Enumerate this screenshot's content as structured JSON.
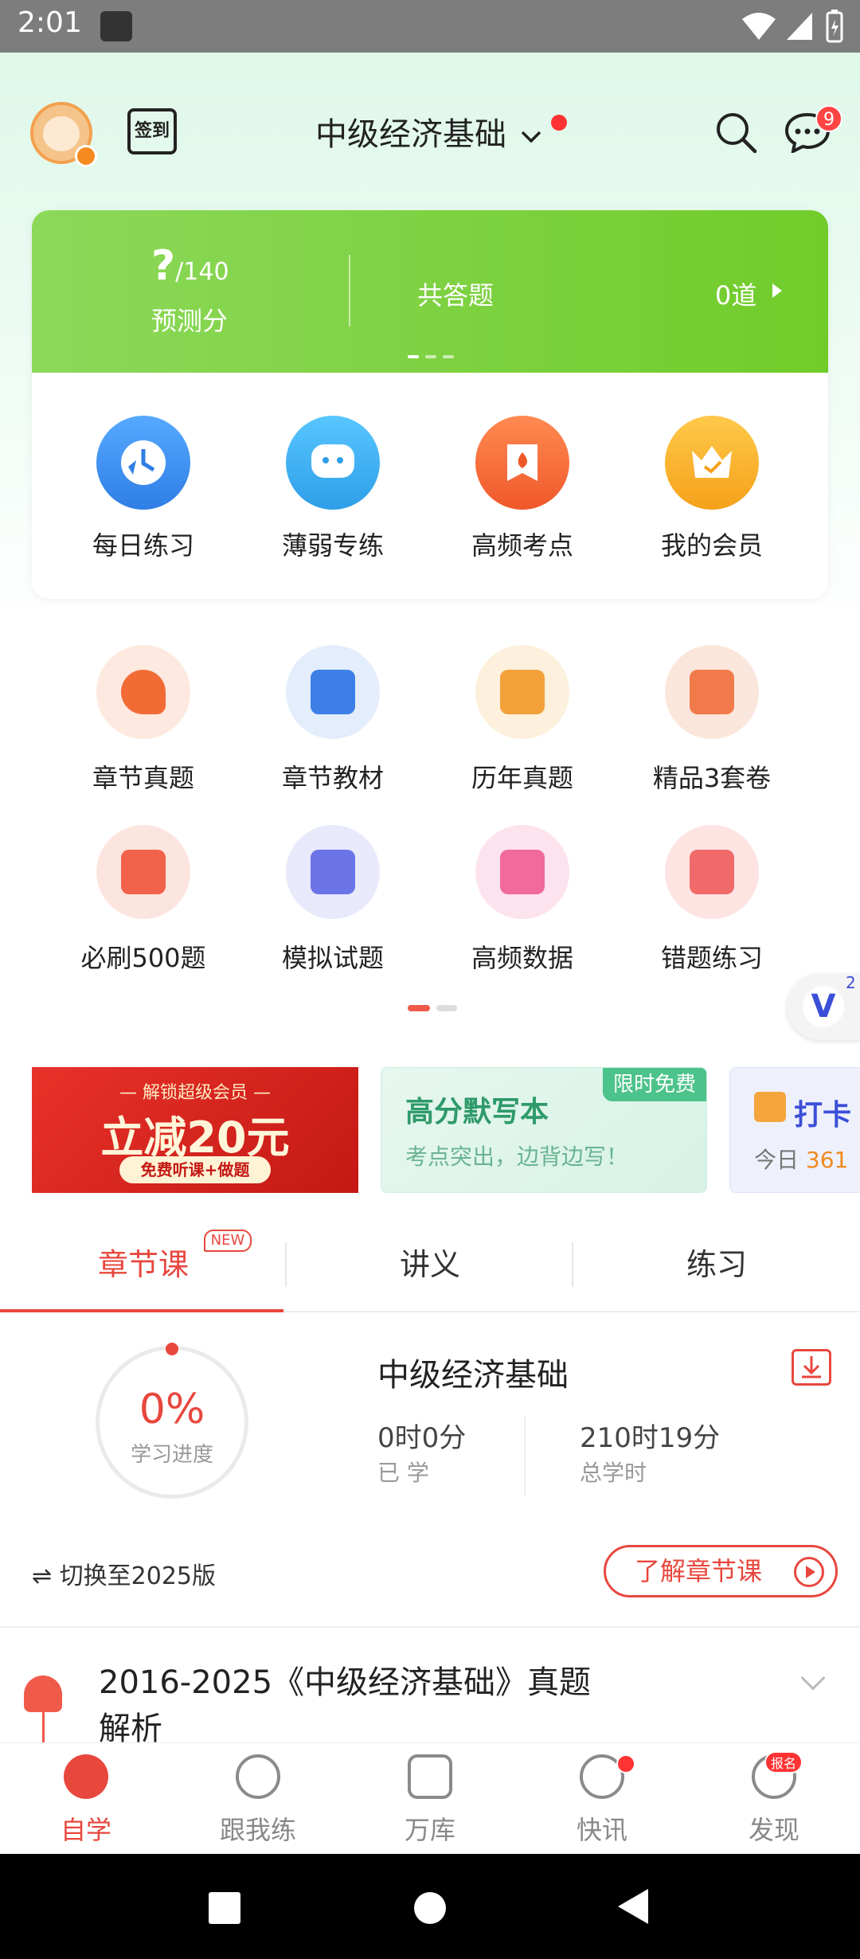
{
  "status_bar": {
    "time": "2:01"
  },
  "header": {
    "checkin_label": "签到",
    "title": "中级经济基础",
    "message_count": "9"
  },
  "score_card": {
    "score": "?",
    "score_total": "/140",
    "score_label": "预测分",
    "total_label": "共答题",
    "total_value": "0道",
    "quick_actions": [
      {
        "label": "每日练习",
        "icon": "clock-icon",
        "color": "#3c8df0"
      },
      {
        "label": "薄弱专练",
        "icon": "chat-bubble-icon",
        "color": "#3aa9ee"
      },
      {
        "label": "高频考点",
        "icon": "flame-icon",
        "color": "#f06236"
      },
      {
        "label": "我的会员",
        "icon": "crown-icon",
        "color": "#f7ae22"
      }
    ]
  },
  "grid": [
    {
      "label": "章节真题",
      "icon": "gear-head-icon",
      "bg": "#fde9df",
      "fg": "#f26b35"
    },
    {
      "label": "章节教材",
      "icon": "shield-book-icon",
      "bg": "#e4edfb",
      "fg": "#3c7fe6"
    },
    {
      "label": "历年真题",
      "icon": "folder-icon",
      "bg": "#fdf0dc",
      "fg": "#f3a13a"
    },
    {
      "label": "精品3套卷",
      "icon": "checklist-icon",
      "bg": "#fbe6dc",
      "fg": "#f07a4a"
    },
    {
      "label": "必刷500题",
      "icon": "500-icon",
      "bg": "#fde5df",
      "fg": "#f0634a"
    },
    {
      "label": "模拟试题",
      "icon": "check-doc-icon",
      "bg": "#e8e9fb",
      "fg": "#6b74e6"
    },
    {
      "label": "高频数据",
      "icon": "pulse-icon",
      "bg": "#fde3ee",
      "fg": "#f06a9a"
    },
    {
      "label": "错题练习",
      "icon": "x-doc-icon",
      "bg": "#fde3e2",
      "fg": "#f06a6a"
    }
  ],
  "floating": {
    "label": "V",
    "count": "2"
  },
  "banners": {
    "b1": {
      "line1": "— 解锁超级会员 —",
      "line2": "立减20元",
      "line3": "免费听课+做题"
    },
    "b2": {
      "title": "高分默写本",
      "subtitle": "考点突出，边背边写！",
      "tag": "限时免费"
    },
    "b3": {
      "title": "打卡",
      "sub_prefix": "今日",
      "sub_num": "361"
    }
  },
  "tabs": [
    {
      "label": "章节课",
      "badge": "NEW"
    },
    {
      "label": "讲义"
    },
    {
      "label": "练习"
    }
  ],
  "course": {
    "progress_value": "0%",
    "progress_label": "学习进度",
    "title": "中级经济基础",
    "learned_value": "0时0分",
    "learned_label": "已 学",
    "total_value": "210时19分",
    "total_label": "总学时",
    "switch_label": "⇌ 切换至2025版",
    "learn_button": "了解章节课",
    "chapter_title": "2016-2025《中级经济基础》真题解析"
  },
  "bottom_nav": [
    {
      "label": "自学",
      "active": true
    },
    {
      "label": "跟我练"
    },
    {
      "label": "万库"
    },
    {
      "label": "快讯"
    },
    {
      "label": "发现",
      "badge": "报名"
    }
  ]
}
